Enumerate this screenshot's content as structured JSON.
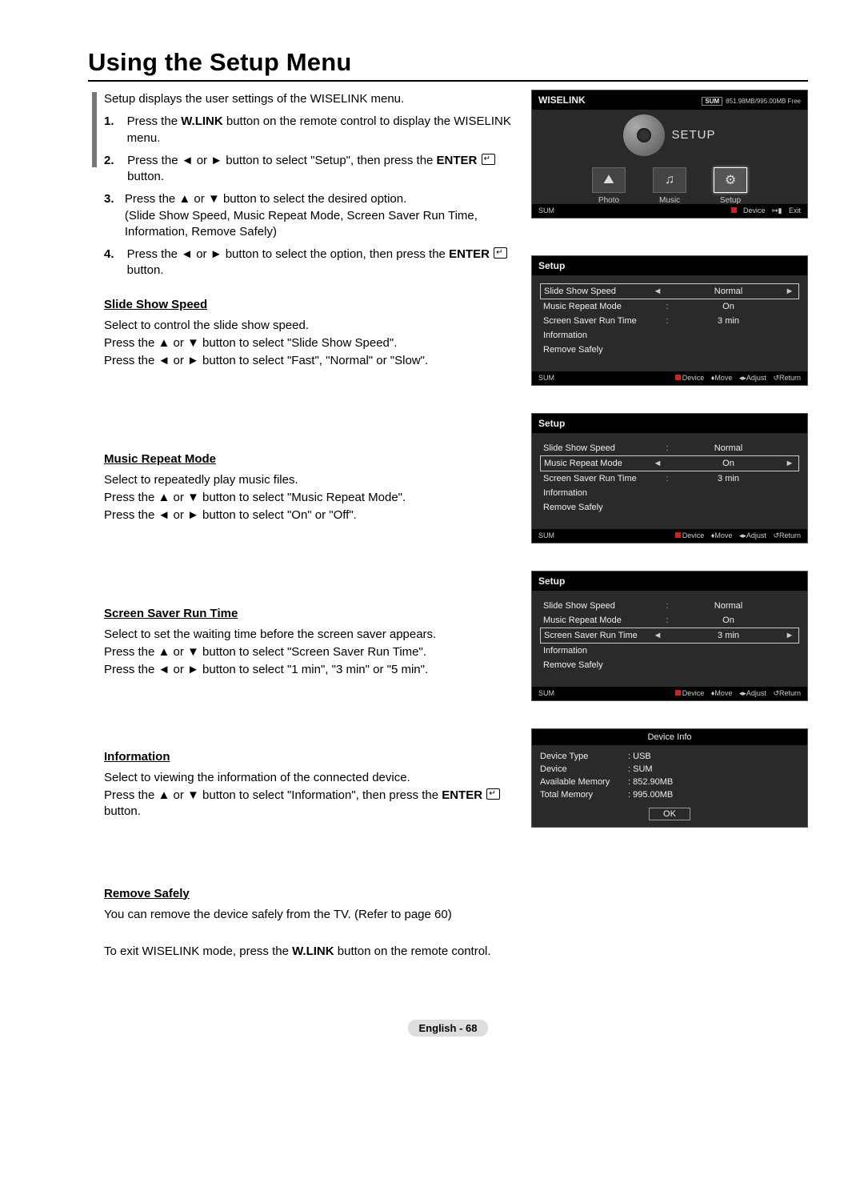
{
  "title": "Using the Setup Menu",
  "intro": "Setup displays the user settings of the WISELINK menu.",
  "steps": [
    {
      "num": "1.",
      "text_a": "Press the ",
      "bold": "W.LINK",
      "text_b": " button on the remote control to display the WISELINK menu."
    },
    {
      "num": "2.",
      "text_a": "Press the ◄ or ► button to select \"Setup\", then press the ",
      "bold": "ENTER",
      "icon": true,
      "text_b": " button."
    },
    {
      "num": "3.",
      "text_a": "Press the ▲ or ▼ button to select the desired option.",
      "extra": "(Slide Show Speed, Music Repeat Mode, Screen Saver Run Time, Information, Remove Safely)"
    },
    {
      "num": "4.",
      "text_a": "Press the ◄ or ► button to select the option, then press the ",
      "bold": "ENTER",
      "icon": true,
      "text_b": " button."
    }
  ],
  "sections": {
    "slide": {
      "heading": "Slide Show Speed",
      "lines": [
        "Select to control the slide show speed.",
        "Press the ▲ or ▼ button to select \"Slide Show Speed\".",
        "Press the ◄ or ► button to select \"Fast\", \"Normal\" or \"Slow\"."
      ]
    },
    "music": {
      "heading": "Music Repeat Mode",
      "lines": [
        "Select to repeatedly play music files.",
        "Press the ▲ or ▼ button to select \"Music Repeat Mode\".",
        "Press the ◄ or ► button to select \"On\" or \"Off\"."
      ]
    },
    "screensaver": {
      "heading": "Screen Saver Run Time",
      "lines": [
        "Select to set the waiting time before the screen saver appears.",
        "Press the ▲ or ▼ button to select \"Screen Saver Run Time\".",
        "Press the ◄ or ► button to select \"1 min\", \"3 min\" or \"5 min\"."
      ]
    },
    "info": {
      "heading": "Information",
      "lines": [
        "Select to viewing the information of the connected device."
      ],
      "enter_line_a": "Press the ▲ or ▼ button to select \"Information\", then press the ",
      "enter_bold": "ENTER",
      "enter_line_b": " button."
    },
    "remove": {
      "heading": "Remove Safely",
      "lines": [
        "You can remove the device safely from the TV. (Refer to page 60)"
      ]
    }
  },
  "exit_a": "To exit WISELINK mode, press the ",
  "exit_bold": "W.LINK",
  "exit_b": " button on the remote control.",
  "footer": "English - 68",
  "wiselink": {
    "title": "WISELINK",
    "mem": "851.98MB/995.00MB Free",
    "sum": "SUM",
    "big_label": "SETUP",
    "icons": [
      {
        "glyph": "⛰",
        "label": "Photo"
      },
      {
        "glyph": "♫",
        "label": "Music"
      },
      {
        "glyph": "⚙",
        "label": "Setup"
      }
    ],
    "footer": {
      "left": "SUM",
      "device": "Device",
      "exit": "Exit"
    }
  },
  "setup_panels": [
    {
      "title": "Setup",
      "rows": [
        {
          "label": "Slide Show Speed",
          "value": "Normal",
          "selected": true
        },
        {
          "label": "Music Repeat Mode",
          "value": "On"
        },
        {
          "label": "Screen Saver Run Time",
          "value": "3 min"
        },
        {
          "label": "Information",
          "value": ""
        },
        {
          "label": "Remove Safely",
          "value": ""
        }
      ]
    },
    {
      "title": "Setup",
      "rows": [
        {
          "label": "Slide Show Speed",
          "value": "Normal"
        },
        {
          "label": "Music Repeat Mode",
          "value": "On",
          "selected": true
        },
        {
          "label": "Screen Saver Run Time",
          "value": "3 min"
        },
        {
          "label": "Information",
          "value": ""
        },
        {
          "label": "Remove Safely",
          "value": ""
        }
      ]
    },
    {
      "title": "Setup",
      "rows": [
        {
          "label": "Slide Show Speed",
          "value": "Normal"
        },
        {
          "label": "Music Repeat Mode",
          "value": "On"
        },
        {
          "label": "Screen Saver Run Time",
          "value": "3 min",
          "selected": true
        },
        {
          "label": "Information",
          "value": ""
        },
        {
          "label": "Remove Safely",
          "value": ""
        }
      ]
    }
  ],
  "setup_footer": {
    "left": "SUM",
    "device": "Device",
    "move": "Move",
    "adjust": "Adjust",
    "ret": "Return"
  },
  "devinfo": {
    "title": "Device Info",
    "rows": [
      {
        "k": "Device Type",
        "v": "USB"
      },
      {
        "k": "Device",
        "v": "SUM"
      },
      {
        "k": "Available Memory",
        "v": "852.90MB"
      },
      {
        "k": "Total Memory",
        "v": "995.00MB"
      }
    ],
    "ok": "OK"
  }
}
